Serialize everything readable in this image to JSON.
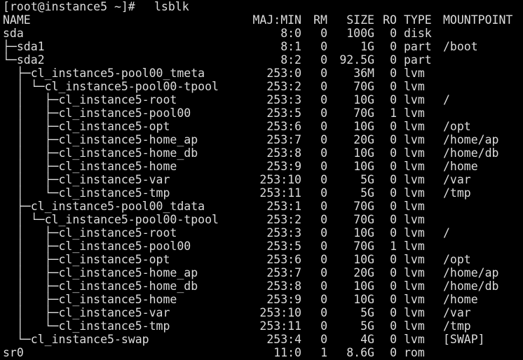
{
  "terminal": {
    "prompt": "[root@instance5 ~]#",
    "command": "lsblk",
    "colors": {
      "background": "#000000",
      "foreground": "#dcdcdc"
    }
  },
  "table": {
    "headers": {
      "name": "NAME",
      "majmin": "MAJ:MIN",
      "rm": "RM",
      "size": "SIZE",
      "ro": "RO",
      "type": "TYPE",
      "mountpoint": "MOUNTPOINT"
    },
    "rows": [
      {
        "name": "sda",
        "majmin": "8:0",
        "rm": "0",
        "size": "100G",
        "ro": "0",
        "type": "disk",
        "mountpoint": ""
      },
      {
        "name": "├─sda1",
        "majmin": "8:1",
        "rm": "0",
        "size": "1G",
        "ro": "0",
        "type": "part",
        "mountpoint": "/boot"
      },
      {
        "name": "└─sda2",
        "majmin": "8:2",
        "rm": "0",
        "size": "92.5G",
        "ro": "0",
        "type": "part",
        "mountpoint": ""
      },
      {
        "name": "  ├─cl_instance5-pool00_tmeta",
        "majmin": "253:0",
        "rm": "0",
        "size": "36M",
        "ro": "0",
        "type": "lvm",
        "mountpoint": ""
      },
      {
        "name": "  │ └─cl_instance5-pool00-tpool",
        "majmin": "253:2",
        "rm": "0",
        "size": "70G",
        "ro": "0",
        "type": "lvm",
        "mountpoint": ""
      },
      {
        "name": "  │   ├─cl_instance5-root",
        "majmin": "253:3",
        "rm": "0",
        "size": "10G",
        "ro": "0",
        "type": "lvm",
        "mountpoint": "/"
      },
      {
        "name": "  │   ├─cl_instance5-pool00",
        "majmin": "253:5",
        "rm": "0",
        "size": "70G",
        "ro": "1",
        "type": "lvm",
        "mountpoint": ""
      },
      {
        "name": "  │   ├─cl_instance5-opt",
        "majmin": "253:6",
        "rm": "0",
        "size": "10G",
        "ro": "0",
        "type": "lvm",
        "mountpoint": "/opt"
      },
      {
        "name": "  │   ├─cl_instance5-home_ap",
        "majmin": "253:7",
        "rm": "0",
        "size": "20G",
        "ro": "0",
        "type": "lvm",
        "mountpoint": "/home/ap"
      },
      {
        "name": "  │   ├─cl_instance5-home_db",
        "majmin": "253:8",
        "rm": "0",
        "size": "10G",
        "ro": "0",
        "type": "lvm",
        "mountpoint": "/home/db"
      },
      {
        "name": "  │   ├─cl_instance5-home",
        "majmin": "253:9",
        "rm": "0",
        "size": "10G",
        "ro": "0",
        "type": "lvm",
        "mountpoint": "/home"
      },
      {
        "name": "  │   ├─cl_instance5-var",
        "majmin": "253:10",
        "rm": "0",
        "size": "5G",
        "ro": "0",
        "type": "lvm",
        "mountpoint": "/var"
      },
      {
        "name": "  │   └─cl_instance5-tmp",
        "majmin": "253:11",
        "rm": "0",
        "size": "5G",
        "ro": "0",
        "type": "lvm",
        "mountpoint": "/tmp"
      },
      {
        "name": "  ├─cl_instance5-pool00_tdata",
        "majmin": "253:1",
        "rm": "0",
        "size": "70G",
        "ro": "0",
        "type": "lvm",
        "mountpoint": ""
      },
      {
        "name": "  │ └─cl_instance5-pool00-tpool",
        "majmin": "253:2",
        "rm": "0",
        "size": "70G",
        "ro": "0",
        "type": "lvm",
        "mountpoint": ""
      },
      {
        "name": "  │   ├─cl_instance5-root",
        "majmin": "253:3",
        "rm": "0",
        "size": "10G",
        "ro": "0",
        "type": "lvm",
        "mountpoint": "/"
      },
      {
        "name": "  │   ├─cl_instance5-pool00",
        "majmin": "253:5",
        "rm": "0",
        "size": "70G",
        "ro": "1",
        "type": "lvm",
        "mountpoint": ""
      },
      {
        "name": "  │   ├─cl_instance5-opt",
        "majmin": "253:6",
        "rm": "0",
        "size": "10G",
        "ro": "0",
        "type": "lvm",
        "mountpoint": "/opt"
      },
      {
        "name": "  │   ├─cl_instance5-home_ap",
        "majmin": "253:7",
        "rm": "0",
        "size": "20G",
        "ro": "0",
        "type": "lvm",
        "mountpoint": "/home/ap"
      },
      {
        "name": "  │   ├─cl_instance5-home_db",
        "majmin": "253:8",
        "rm": "0",
        "size": "10G",
        "ro": "0",
        "type": "lvm",
        "mountpoint": "/home/db"
      },
      {
        "name": "  │   ├─cl_instance5-home",
        "majmin": "253:9",
        "rm": "0",
        "size": "10G",
        "ro": "0",
        "type": "lvm",
        "mountpoint": "/home"
      },
      {
        "name": "  │   ├─cl_instance5-var",
        "majmin": "253:10",
        "rm": "0",
        "size": "5G",
        "ro": "0",
        "type": "lvm",
        "mountpoint": "/var"
      },
      {
        "name": "  │   └─cl_instance5-tmp",
        "majmin": "253:11",
        "rm": "0",
        "size": "5G",
        "ro": "0",
        "type": "lvm",
        "mountpoint": "/tmp"
      },
      {
        "name": "  └─cl_instance5-swap",
        "majmin": "253:4",
        "rm": "0",
        "size": "4G",
        "ro": "0",
        "type": "lvm",
        "mountpoint": "[SWAP]"
      },
      {
        "name": "sr0",
        "majmin": "11:0",
        "rm": "1",
        "size": "8.6G",
        "ro": "0",
        "type": "rom",
        "mountpoint": ""
      }
    ]
  }
}
